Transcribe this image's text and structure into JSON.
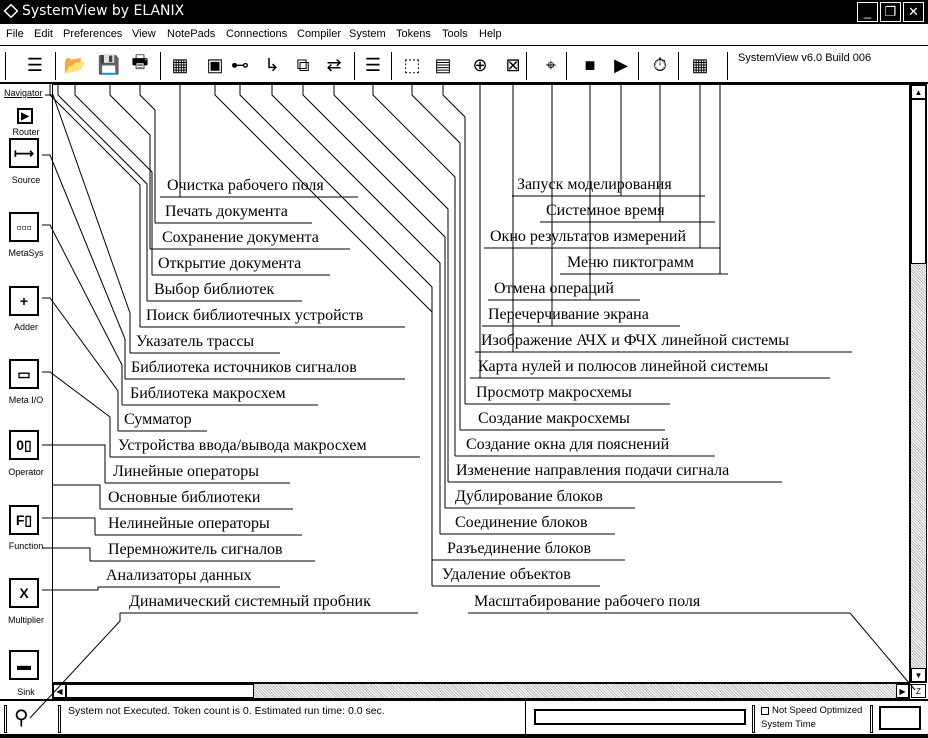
{
  "window": {
    "title": "SystemView by ELANIX",
    "minimize": "_",
    "restore": "❐",
    "close": "✕"
  },
  "menu": [
    "File",
    "Edit",
    "Preferences",
    "View",
    "NotePads",
    "Connections",
    "Compiler",
    "System",
    "Tokens",
    "Tools",
    "Help"
  ],
  "toolbar": {
    "version": "SystemView v6.0 Build 006"
  },
  "sidebar": {
    "header": "Navigator",
    "items": [
      {
        "label": "Router",
        "icon": "▶"
      },
      {
        "label": "Source",
        "icon": "⟼"
      },
      {
        "label": "MetaSys",
        "icon": "▫▫▫"
      },
      {
        "label": "Adder",
        "icon": "+"
      },
      {
        "label": "Meta I/O",
        "icon": "▭"
      },
      {
        "label": "Operator",
        "icon": "0▯"
      },
      {
        "label": "Function",
        "icon": "F▯"
      },
      {
        "label": "Multiplier",
        "icon": "X"
      },
      {
        "label": "Sink",
        "icon": "▬"
      }
    ]
  },
  "status": {
    "message": "System not Executed. Token count is 0.  Estimated run time: 0.0 sec.",
    "speed": "Not Speed Optimized",
    "time_label": "System Time"
  },
  "scroll": {
    "zoom_button": "Z"
  },
  "annotations_left": [
    "Очистка рабочего поля",
    "Печать документа",
    "Сохранение документа",
    "Открытие документа",
    "Выбор библиотек",
    "Поиск библиотечных устройств",
    "Указатель трассы",
    "Библиотека источников сигналов",
    "Библиотека макросхем",
    "Сумматор",
    "Устройства ввода/вывода макросхем",
    "Линейные операторы",
    "Основные библиотеки",
    "Нелинейные операторы",
    "Перемножитель сигналов",
    "Анализаторы данных",
    "Динамический системный пробник"
  ],
  "annotations_right": [
    "Запуск моделирования",
    "Системное время",
    "Окно результатов измерений",
    "Меню пиктограмм",
    "Отмена операций",
    "Перечерчивание экрана",
    "Изображение АЧХ и ФЧХ линейной системы",
    "Карта нулей и полюсов линейной системы",
    "Просмотр макросхемы",
    "Создание макросхемы",
    "Создание окна для пояснений",
    "Изменение направления подачи сигнала",
    "Дублирование блоков",
    "Соединение блоков",
    "Разъединение блоков",
    "Удаление объектов",
    "Масштабирование рабочего поля"
  ]
}
